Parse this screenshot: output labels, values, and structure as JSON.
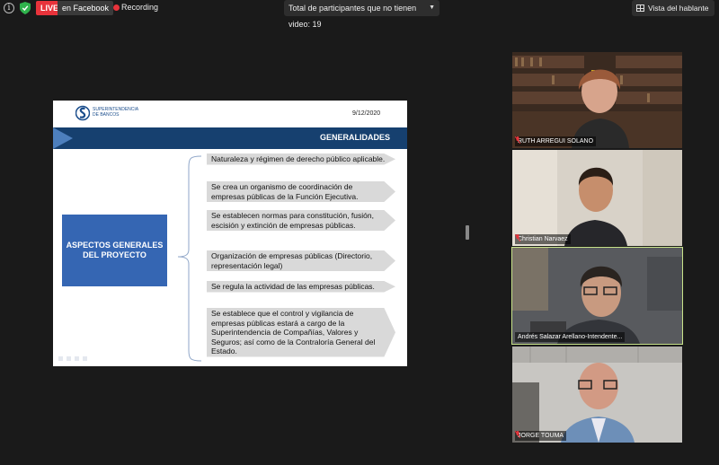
{
  "topbar": {
    "info_icon": "info-icon",
    "shield_icon": "shield-check-icon",
    "live_badge": "LIVE",
    "live_destination": "en Facebook",
    "recording_label": "Recording",
    "spotlight_dropdown": "Total de participantes que no tienen video: 19",
    "view_button": "Vista del hablante",
    "colors": {
      "live": "#e8333b",
      "bar": "#1a1a1a",
      "active_speaker": "#c8e38a"
    }
  },
  "slide": {
    "logo_text": "SUPERINTENDENCIA\nDE BANCOS",
    "date": "9/12/2020",
    "section_title": "GENERALIDADES",
    "aspect_box": "ASPECTOS GENERALES DEL PROYECTO",
    "items": [
      "Naturaleza y régimen de derecho público aplicable.",
      "Se crea un organismo de coordinación de empresas públicas de la Función Ejecutiva.",
      "Se establecen normas para constitución, fusión, escisión y extinción de empresas públicas.",
      "Organización de empresas públicas (Directorio, representación legal)",
      "Se regula la actividad de las empresas públicas.",
      "Se establece que el control y vigilancia de empresas públicas estará a cargo de la Superintendencia de Compañías, Valores y Seguros; así como de la Contraloría General del Estado."
    ],
    "colors": {
      "band": "#16406f",
      "box": "#3566b3",
      "item_bg": "#d9d9d9"
    }
  },
  "participants": [
    {
      "name": "RUTH ARREGUI SOLANO",
      "muted": true
    },
    {
      "name": "Christian Narvaez",
      "muted": true
    },
    {
      "name": "Andrés Salazar Arellano-Intendente...",
      "muted": false
    },
    {
      "name": "JORGE TOUMA",
      "muted": true
    }
  ]
}
